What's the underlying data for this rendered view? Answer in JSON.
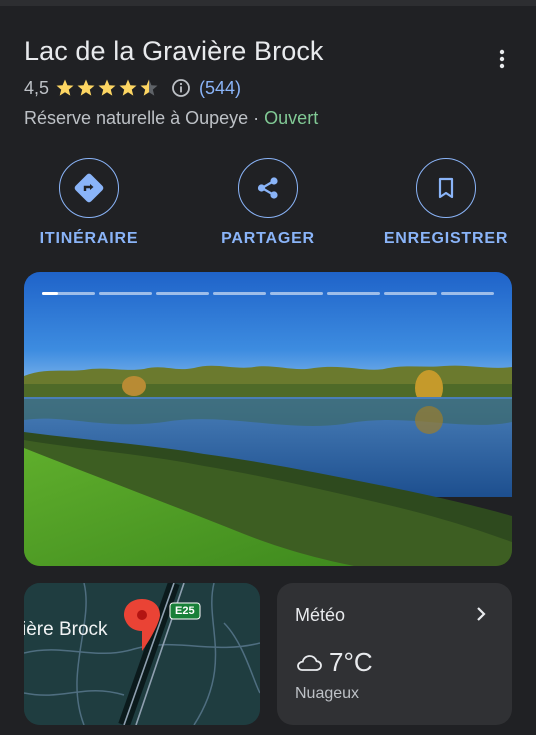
{
  "place": {
    "name": "Lac de la Gravière Brock",
    "rating": "4,5",
    "stars": 4.5,
    "review_count": "(544)",
    "category": "Réserve naturelle à Oupeye",
    "separator": "·",
    "status": "Ouvert"
  },
  "actions": [
    {
      "label": "ITINÉRAIRE",
      "icon": "directions-icon"
    },
    {
      "label": "PARTAGER",
      "icon": "share-icon"
    },
    {
      "label": "ENREGISTRER",
      "icon": "bookmark-icon"
    }
  ],
  "photo": {
    "segments": 8,
    "current": 1
  },
  "map": {
    "place_label": "ière Brock",
    "road_badge": "E25"
  },
  "weather": {
    "title": "Météo",
    "temperature": "7°C",
    "condition": "Nuageux",
    "icon": "cloud-icon"
  },
  "colors": {
    "background": "#202124",
    "accent": "#8ab4f8",
    "star": "#fdd663",
    "open": "#81c995",
    "pin": "#ea4335",
    "road_badge": "#188038"
  }
}
